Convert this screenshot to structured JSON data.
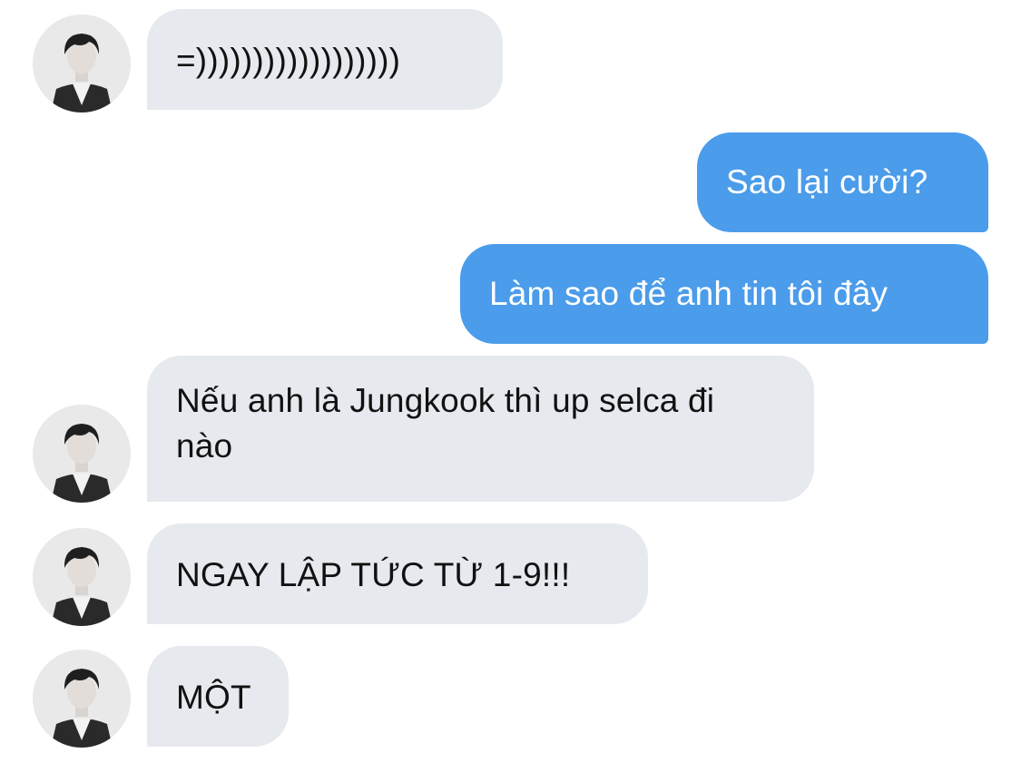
{
  "colors": {
    "incoming_bubble": "#e6e9ee",
    "outgoing_bubble": "#4b9cea",
    "incoming_text": "#111111",
    "outgoing_text": "#ffffff"
  },
  "messages": [
    {
      "sender": "contact",
      "text": "=))))))))))))))))))",
      "avatar": "contact-avatar-icon"
    },
    {
      "sender": "me",
      "text": "Sao lại cười?"
    },
    {
      "sender": "me",
      "text": "Làm sao để anh tin tôi đây"
    },
    {
      "sender": "contact",
      "text": "Nếu anh là Jungkook thì up selca đi nào",
      "avatar": "contact-avatar-icon"
    },
    {
      "sender": "contact",
      "text": "NGAY LẬP TỨC TỪ 1-9!!!",
      "avatar": "contact-avatar-icon"
    },
    {
      "sender": "contact",
      "text": "MỘT",
      "avatar": "contact-avatar-icon"
    }
  ]
}
